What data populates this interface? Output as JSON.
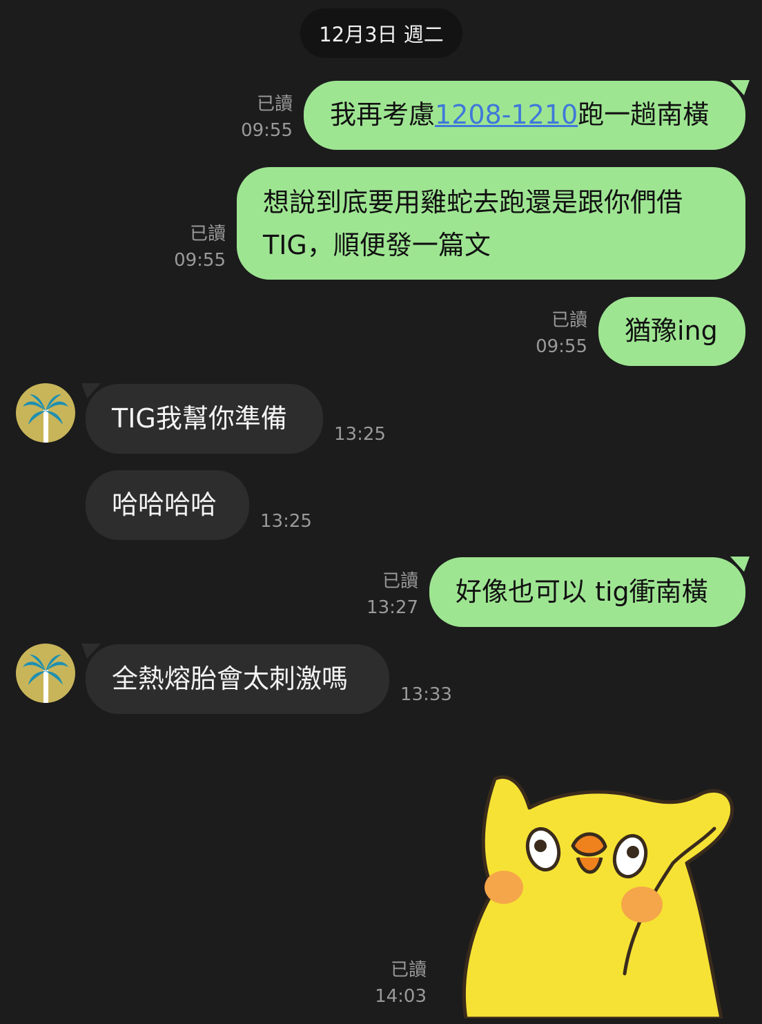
{
  "date_divider": "12月3日 週二",
  "messages": [
    {
      "text_before": "我再考慮",
      "link": "1208-1210",
      "text_after": "跑一趟南橫",
      "read": "已讀",
      "time": "09:55"
    },
    {
      "line1": "想說到底要用雞蛇去跑還是跟你們借",
      "line2": "TIG，順便發一篇文",
      "read": "已讀",
      "time": "09:55"
    },
    {
      "text": "猶豫ing",
      "read": "已讀",
      "time": "09:55"
    },
    {
      "text": "TIG我幫你準備",
      "time": "13:25"
    },
    {
      "text": "哈哈哈哈",
      "time": "13:25"
    },
    {
      "text": "好像也可以 tig衝南橫",
      "read": "已讀",
      "time": "13:27"
    },
    {
      "text": "全熱熔胎會太刺激嗎",
      "time": "13:33"
    },
    {
      "read": "已讀",
      "time": "14:03"
    }
  ],
  "icons": {
    "avatar": "palm-tree-avatar-icon",
    "sticker": "yellow-bird-sticker"
  },
  "colors": {
    "background": "#1c1c1c",
    "outgoing_bubble": "#9ee592",
    "incoming_bubble": "#2d2d2d",
    "link": "#3f78d9",
    "avatar_bg": "#c8b55a",
    "palm": "#1f8fb0"
  }
}
